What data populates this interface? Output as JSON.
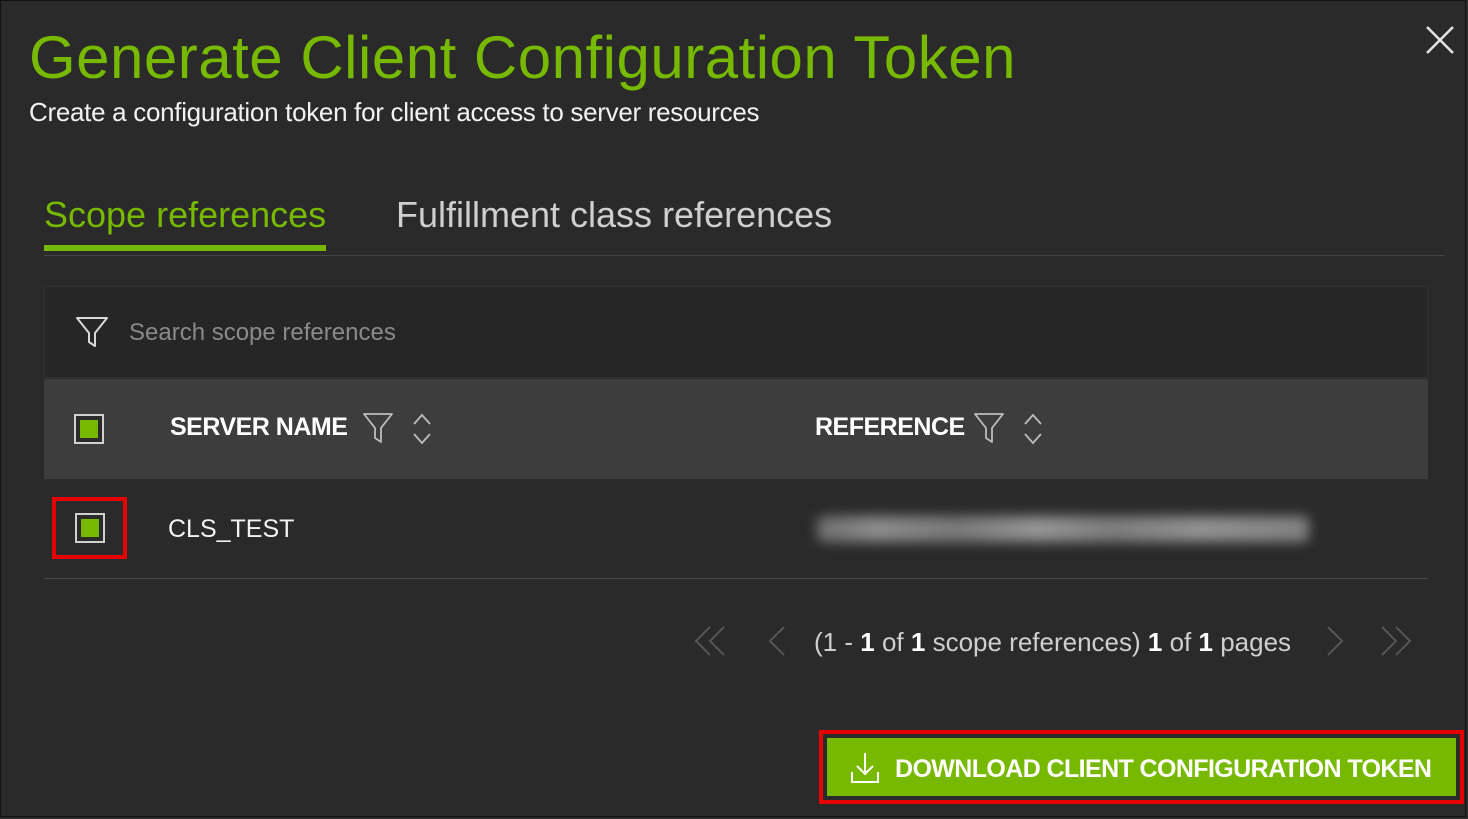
{
  "dialog": {
    "title": "Generate Client Configuration Token",
    "subtitle": "Create a configuration token for client access to server resources"
  },
  "tabs": [
    {
      "label": "Scope references",
      "active": true
    },
    {
      "label": "Fulfillment class references",
      "active": false
    }
  ],
  "search": {
    "placeholder": "Search scope references",
    "value": "",
    "icon": "filter-icon"
  },
  "table": {
    "columns": [
      "SERVER NAME",
      "REFERENCE"
    ],
    "select_all_checked": true,
    "rows": [
      {
        "server_name": "CLS_TEST",
        "reference": "",
        "checked": true
      }
    ]
  },
  "pagination": {
    "range_start": "1",
    "range_end": "1",
    "total": "1",
    "unit": "scope references",
    "page": "1",
    "pages": "1",
    "pages_label": "pages"
  },
  "actions": {
    "download_label": "DOWNLOAD CLIENT CONFIGURATION TOKEN",
    "download_icon": "download-icon"
  },
  "colors": {
    "accent": "#76b900",
    "background": "#2a2a2a",
    "header_bg": "#3d3d3d",
    "highlight": "#e60000"
  }
}
